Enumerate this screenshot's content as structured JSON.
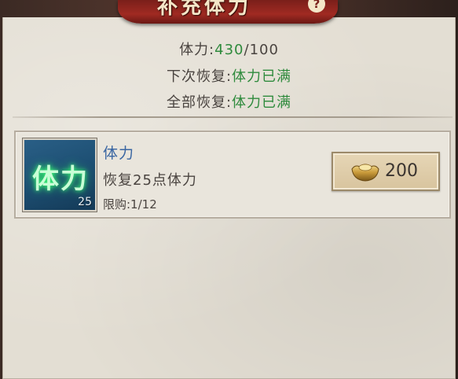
{
  "header": {
    "title": "补充体力",
    "help_label": "?"
  },
  "stats": {
    "stamina_label": "体力:",
    "stamina_current": "430",
    "stamina_sep": "/",
    "stamina_max": "100",
    "next_recover_label": "下次恢复:",
    "next_recover_value": "体力已满",
    "full_recover_label": "全部恢复:",
    "full_recover_value": "体力已满"
  },
  "item": {
    "icon_glyph": "体力",
    "icon_count": "25",
    "name": "体力",
    "description": "恢复25点体力",
    "limit": "限购:1/12",
    "price": "200",
    "price_icon": "gold-ingot-icon"
  },
  "colors": {
    "green_value": "#2e8a3c",
    "item_name_blue": "#3a66a2",
    "banner_red": "#a02a22",
    "panel_bg": "#e3ded3"
  }
}
